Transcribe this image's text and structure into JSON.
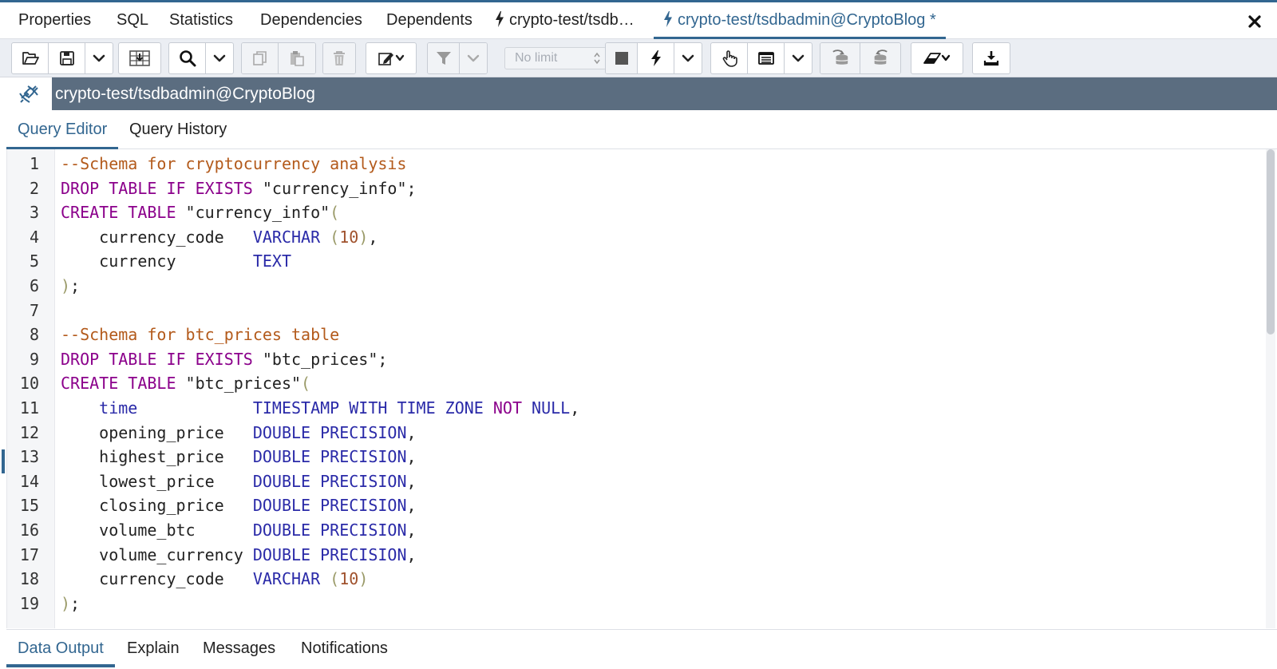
{
  "colors": {
    "accent": "#326690",
    "connection_bar": "#5b6d80",
    "toolbar_bg": "#ebeef3",
    "comment": "#b35a1b",
    "keyword": "#8b008b",
    "type": "#2a2aa8",
    "number": "#a0522d"
  },
  "tabs": [
    {
      "label": "Properties",
      "icon": "",
      "active": false
    },
    {
      "label": "SQL",
      "icon": "",
      "active": false
    },
    {
      "label": "Statistics",
      "icon": "",
      "active": false
    },
    {
      "label": "Dependencies",
      "icon": "",
      "active": false
    },
    {
      "label": "Dependents",
      "icon": "",
      "active": false
    },
    {
      "label": "crypto-test/tsdb…",
      "icon": "lightning-icon",
      "active": false
    },
    {
      "label": "crypto-test/tsdbadmin@CryptoBlog *",
      "icon": "lightning-icon",
      "active": true
    }
  ],
  "toolbar": {
    "limit_value": "No limit",
    "icons": [
      "open-file-icon",
      "save-icon",
      "chevron-down-icon",
      "save-data-icon",
      "search-icon",
      "chevron-down-icon",
      "copy-icon",
      "paste-icon",
      "delete-icon",
      "edit-icon",
      "chevron-down-icon",
      "filter-icon",
      "chevron-down-icon",
      "stop-icon",
      "execute-icon",
      "chevron-down-icon",
      "explain-icon",
      "explain-analyze-icon",
      "chevron-down-icon",
      "commit-icon",
      "rollback-icon",
      "clear-icon",
      "chevron-down-icon",
      "download-icon"
    ]
  },
  "connection": {
    "label": "crypto-test/tsdbadmin@CryptoBlog",
    "icon": "connection-link-icon"
  },
  "editor_tabs": [
    {
      "label": "Query Editor",
      "active": true
    },
    {
      "label": "Query History",
      "active": false
    }
  ],
  "editor": {
    "lines": [
      {
        "num": "1",
        "tokens": [
          {
            "t": "--Schema for cryptocurrency analysis",
            "c": "comment"
          }
        ]
      },
      {
        "num": "2",
        "tokens": [
          {
            "t": "DROP TABLE IF EXISTS",
            "c": "kw"
          },
          {
            "t": " \"currency_info\";",
            "c": "str"
          }
        ]
      },
      {
        "num": "3",
        "tokens": [
          {
            "t": "CREATE TABLE",
            "c": "kw"
          },
          {
            "t": " \"currency_info\"",
            "c": "str"
          },
          {
            "t": "(",
            "c": "paren"
          }
        ]
      },
      {
        "num": "4",
        "tokens": [
          {
            "t": "    currency_code   ",
            "c": "str"
          },
          {
            "t": "VARCHAR",
            "c": "type"
          },
          {
            "t": " (",
            "c": "paren"
          },
          {
            "t": "10",
            "c": "num"
          },
          {
            "t": ")",
            "c": "paren"
          },
          {
            "t": ",",
            "c": "str"
          }
        ]
      },
      {
        "num": "5",
        "tokens": [
          {
            "t": "    currency        ",
            "c": "str"
          },
          {
            "t": "TEXT",
            "c": "type"
          }
        ]
      },
      {
        "num": "6",
        "tokens": [
          {
            "t": ")",
            "c": "paren"
          },
          {
            "t": ";",
            "c": "str"
          }
        ]
      },
      {
        "num": "7",
        "tokens": []
      },
      {
        "num": "8",
        "tokens": [
          {
            "t": "--Schema for btc_prices table",
            "c": "comment"
          }
        ]
      },
      {
        "num": "9",
        "tokens": [
          {
            "t": "DROP TABLE IF EXISTS",
            "c": "kw"
          },
          {
            "t": " \"btc_prices\";",
            "c": "str"
          }
        ]
      },
      {
        "num": "10",
        "tokens": [
          {
            "t": "CREATE TABLE",
            "c": "kw"
          },
          {
            "t": " \"btc_prices\"",
            "c": "str"
          },
          {
            "t": "(",
            "c": "paren"
          }
        ]
      },
      {
        "num": "11",
        "tokens": [
          {
            "t": "    ",
            "c": "str"
          },
          {
            "t": "time",
            "c": "type"
          },
          {
            "t": "            ",
            "c": "str"
          },
          {
            "t": "TIMESTAMP WITH TIME ZONE",
            "c": "type"
          },
          {
            "t": " ",
            "c": "str"
          },
          {
            "t": "NOT",
            "c": "kw"
          },
          {
            "t": " ",
            "c": "str"
          },
          {
            "t": "NULL",
            "c": "type"
          },
          {
            "t": ",",
            "c": "str"
          }
        ]
      },
      {
        "num": "12",
        "tokens": [
          {
            "t": "    opening_price   ",
            "c": "str"
          },
          {
            "t": "DOUBLE PRECISION",
            "c": "type"
          },
          {
            "t": ",",
            "c": "str"
          }
        ]
      },
      {
        "num": "13",
        "tokens": [
          {
            "t": "    highest_price   ",
            "c": "str"
          },
          {
            "t": "DOUBLE PRECISION",
            "c": "type"
          },
          {
            "t": ",",
            "c": "str"
          }
        ]
      },
      {
        "num": "14",
        "tokens": [
          {
            "t": "    lowest_price    ",
            "c": "str"
          },
          {
            "t": "DOUBLE PRECISION",
            "c": "type"
          },
          {
            "t": ",",
            "c": "str"
          }
        ]
      },
      {
        "num": "15",
        "tokens": [
          {
            "t": "    closing_price   ",
            "c": "str"
          },
          {
            "t": "DOUBLE PRECISION",
            "c": "type"
          },
          {
            "t": ",",
            "c": "str"
          }
        ]
      },
      {
        "num": "16",
        "tokens": [
          {
            "t": "    volume_btc      ",
            "c": "str"
          },
          {
            "t": "DOUBLE PRECISION",
            "c": "type"
          },
          {
            "t": ",",
            "c": "str"
          }
        ]
      },
      {
        "num": "17",
        "tokens": [
          {
            "t": "    volume_currency ",
            "c": "str"
          },
          {
            "t": "DOUBLE PRECISION",
            "c": "type"
          },
          {
            "t": ",",
            "c": "str"
          }
        ]
      },
      {
        "num": "18",
        "tokens": [
          {
            "t": "    currency_code   ",
            "c": "str"
          },
          {
            "t": "VARCHAR",
            "c": "type"
          },
          {
            "t": " (",
            "c": "paren"
          },
          {
            "t": "10",
            "c": "num"
          },
          {
            "t": ")",
            "c": "paren"
          }
        ]
      },
      {
        "num": "19",
        "tokens": [
          {
            "t": ")",
            "c": "paren"
          },
          {
            "t": ";",
            "c": "str"
          }
        ]
      }
    ]
  },
  "output_tabs": [
    {
      "label": "Data Output",
      "active": true
    },
    {
      "label": "Explain",
      "active": false
    },
    {
      "label": "Messages",
      "active": false
    },
    {
      "label": "Notifications",
      "active": false
    }
  ]
}
